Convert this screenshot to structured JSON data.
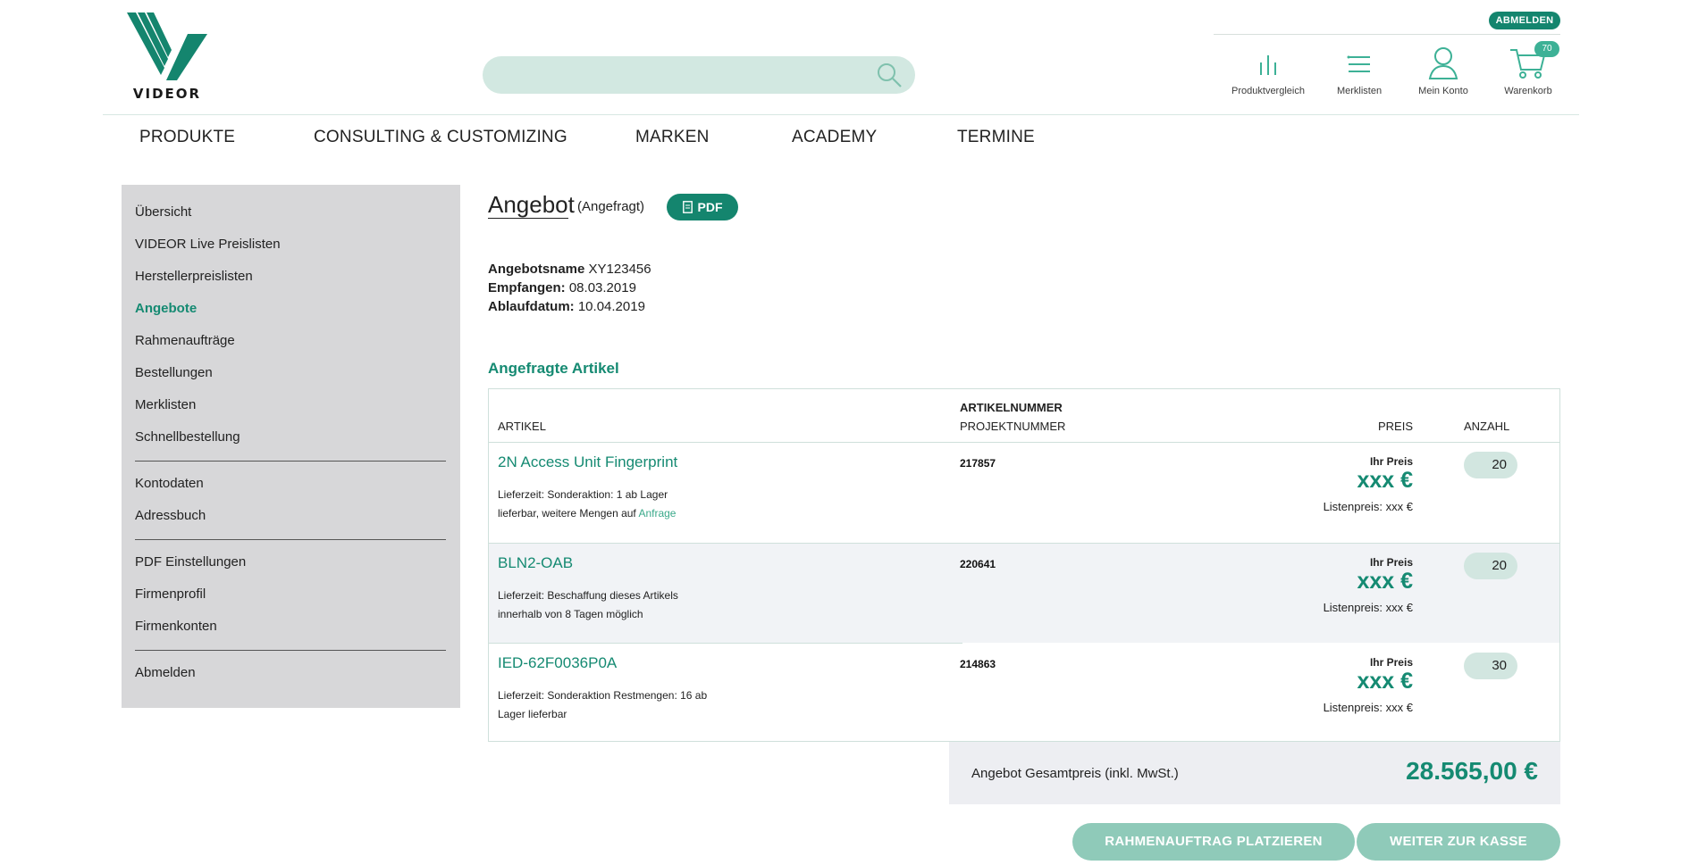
{
  "brand": {
    "name": "VIDEOR"
  },
  "header": {
    "logout_label": "ABMELDEN",
    "search_placeholder": "",
    "icons": [
      {
        "label": "Produktvergleich",
        "icon": "compare-icon"
      },
      {
        "label": "Merklisten",
        "icon": "list-icon"
      },
      {
        "label": "Mein Konto",
        "icon": "user-icon"
      },
      {
        "label": "Warenkorb",
        "icon": "cart-icon"
      }
    ],
    "cart_count": "70"
  },
  "nav": [
    "PRODUKTE",
    "CONSULTING & CUSTOMIZING",
    "MARKEN",
    "ACADEMY",
    "TERMINE"
  ],
  "sidebar": {
    "group1": [
      "Übersicht",
      "VIDEOR Live Preislisten",
      "Herstellerpreislisten",
      "Angebote",
      "Rahmenaufträge",
      "Bestellungen",
      "Merklisten",
      "Schnellbestellung"
    ],
    "group2": [
      "Kontodaten",
      "Adressbuch"
    ],
    "group3": [
      "PDF Einstellungen",
      "Firmenprofil",
      "Firmenkonten"
    ],
    "group4": [
      "Abmelden"
    ],
    "active": "Angebote"
  },
  "offer": {
    "title": "Angebot",
    "status": "(Angefragt)",
    "pdf_label": "PDF",
    "meta": [
      {
        "label": "Angebotsname",
        "value": "XY123456"
      },
      {
        "label": "Empfangen:",
        "value": "08.03.2019"
      },
      {
        "label": "Ablaufdatum:",
        "value": "10.04.2019"
      }
    ],
    "section_title": "Angefragte Artikel"
  },
  "table": {
    "headers": {
      "artikel": "ARTIKEL",
      "artikelnummer": "ARTIKELNUMMER",
      "projektnummer": "PROJEKTNUMMER",
      "preis": "PREIS",
      "anzahl": "ANZAHL"
    },
    "rows": [
      {
        "name": "2N Access Unit Fingerprint",
        "desc1": "Lieferzeit: Sonderaktion: 1 ab Lager",
        "desc2": "lieferbar, weitere Mengen auf ",
        "desc_link": "Anfrage",
        "number": "217857",
        "price_label": "Ihr Preis",
        "price": "xxx €",
        "list_price": "Listenpreis: xxx €",
        "qty": "20"
      },
      {
        "name": "BLN2-OAB",
        "desc1": "Lieferzeit: Beschaffung dieses Artikels",
        "desc2": "innerhalb von 8 Tagen möglich",
        "desc_link": "",
        "number": "220641",
        "price_label": "Ihr Preis",
        "price": "xxx €",
        "list_price": "Listenpreis: xxx €",
        "qty": "20"
      },
      {
        "name": "IED-62F0036P0A",
        "desc1": "Lieferzeit: Sonderaktion Restmengen: 16 ab",
        "desc2": "Lager lieferbar",
        "desc_link": "",
        "number": "214863",
        "price_label": "Ihr Preis",
        "price": "xxx €",
        "list_price": "Listenpreis: xxx €",
        "qty": "30"
      }
    ]
  },
  "total": {
    "label": "Angebot Gesamtpreis (inkl. MwSt.)",
    "value": "28.565,00 €"
  },
  "actions": {
    "frame_order": "RAHMENAUFTRAG PLATZIEREN",
    "checkout": "WEITER ZUR KASSE"
  },
  "colors": {
    "accent": "#14856e",
    "accent_text": "#158a72",
    "search_bg": "#d2e8e1",
    "cta_bg": "#8fcab9",
    "sidebar_bg": "#d7d7d9"
  }
}
